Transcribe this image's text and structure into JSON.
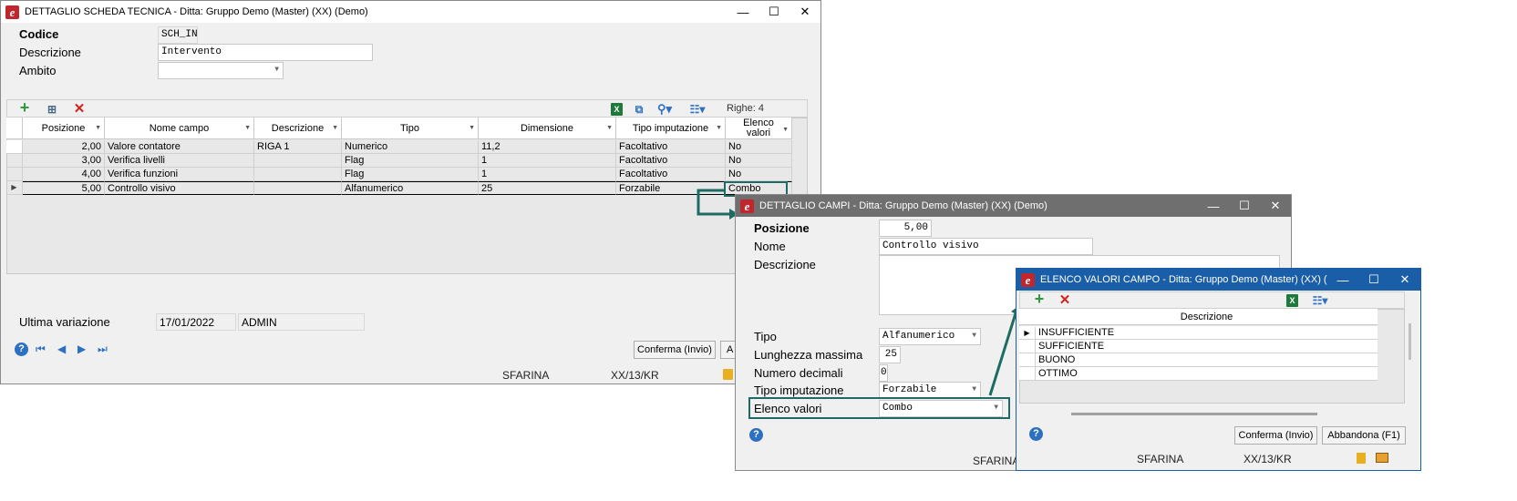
{
  "win1": {
    "title": "DETTAGLIO SCHEDA TECNICA - Ditta: Gruppo Demo (Master) (XX)  (Demo)",
    "codice_label": "Codice",
    "codice_value": "SCH_IN",
    "descrizione_label": "Descrizione",
    "descrizione_value": "Intervento",
    "ambito_label": "Ambito",
    "ambito_value": "",
    "righe": "Righe: 4",
    "columns": [
      "Posizione",
      "Nome campo",
      "Descrizione",
      "Tipo",
      "Dimensione",
      "Tipo imputazione",
      "Elenco valori"
    ],
    "rows": [
      [
        "2,00",
        "Valore contatore",
        "RIGA 1",
        "Numerico",
        "11,2",
        "Facoltativo",
        "No"
      ],
      [
        "3,00",
        "Verifica livelli",
        "",
        "Flag",
        "1",
        "Facoltativo",
        "No"
      ],
      [
        "4,00",
        "Verifica funzioni",
        "",
        "Flag",
        "1",
        "Facoltativo",
        "No"
      ],
      [
        "5,00",
        "Controllo visivo",
        "",
        "Alfanumerico",
        "25",
        "Forzabile",
        "Combo"
      ]
    ],
    "ultima_label": "Ultima variazione",
    "ultima_date": "17/01/2022",
    "ultima_user": "ADMIN",
    "conferma": "Conferma (Invio)",
    "abbandona_partial": "A",
    "status_user": "SFARINA",
    "status_code": "XX/13/KR"
  },
  "win2": {
    "title": "DETTAGLIO CAMPI - Ditta: Gruppo Demo (Master) (XX)  (Demo)",
    "posizione_label": "Posizione",
    "posizione_value": "5,00",
    "nome_label": "Nome",
    "nome_value": "Controllo visivo",
    "descrizione_label": "Descrizione",
    "tipo_label": "Tipo",
    "tipo_value": "Alfanumerico",
    "lunghezza_label": "Lunghezza massima",
    "lunghezza_value": "25",
    "decimali_label": "Numero decimali",
    "decimali_value": "0",
    "imputazione_label": "Tipo imputazione",
    "imputazione_value": "Forzabile",
    "elenco_label": "Elenco valori",
    "elenco_value": "Combo",
    "status_user": "SFARINA"
  },
  "win3": {
    "title": "ELENCO VALORI CAMPO - Ditta: Gruppo Demo (Master) (XX)  (De...",
    "column": "Descrizione",
    "values": [
      "INSUFFICIENTE",
      "SUFFICIENTE",
      "BUONO",
      "OTTIMO"
    ],
    "conferma": "Conferma (Invio)",
    "abbandona": "Abbandona (F1)",
    "status_user": "SFARINA",
    "status_code": "XX/13/KR"
  },
  "colors": {
    "accent": "#1e6b64",
    "help_blue": "#2d6fc0",
    "title_blue": "#1a5ea8"
  }
}
